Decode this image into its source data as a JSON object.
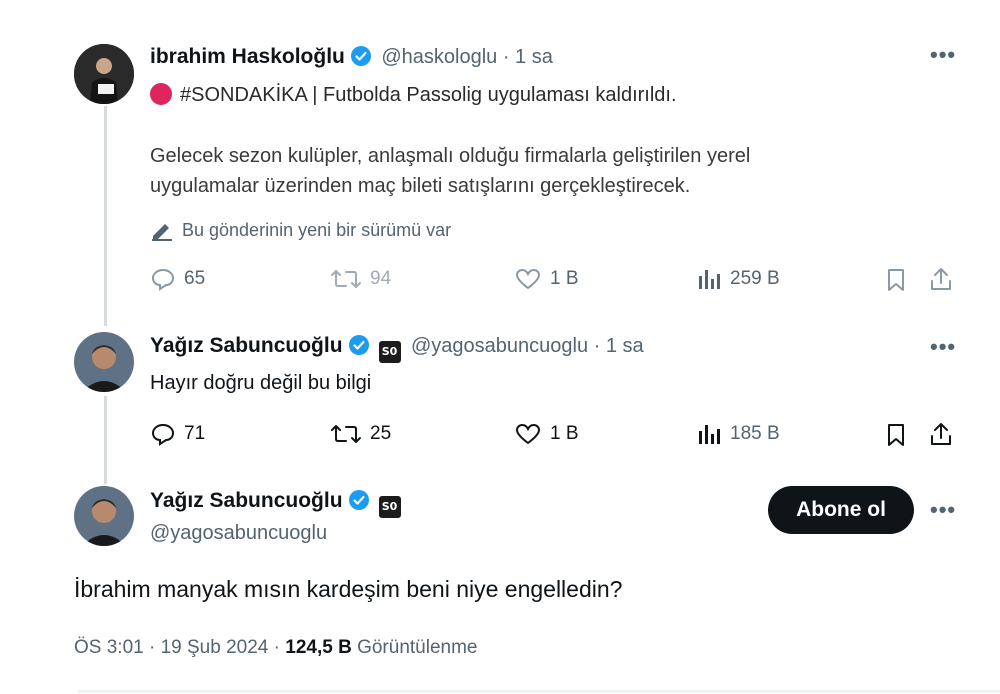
{
  "tweet1": {
    "author_name": "ibrahim Haskoloğlu",
    "handle_time": "@haskologlu · 1 sa",
    "headline": "#SONDAKİKA | Futbolda Passolig uygulaması kaldırıldı.",
    "body_line1": "Gelecek sezon kulüpler, anlaşmalı olduğu firmalarla geliştirilen yerel",
    "body_line2": "uygulamalar üzerinden maç bileti satışlarını gerçekleştirecek.",
    "edit_notice": "Bu gönderinin yeni bir sürümü var",
    "replies": "65",
    "retweets": "94",
    "likes": "1 B",
    "views": "259 B"
  },
  "tweet2": {
    "author_name": "Yağız Sabuncuoğlu",
    "badge": "S0",
    "handle_time": "@yagosabuncuoglu · 1 sa",
    "body": "Hayır doğru değil bu bilgi",
    "replies": "71",
    "retweets": "25",
    "likes": "1 B",
    "views": "185 B"
  },
  "main_tweet": {
    "author_name": "Yağız Sabuncuoğlu",
    "badge": "S0",
    "handle": "@yagosabuncuoglu",
    "subscribe_label": "Abone ol",
    "body": "İbrahim manyak mısın kardeşim beni niye engelledin?",
    "timestamp": "ÖS 3:01 · 19 Şub 2024 · ",
    "views_count": "124,5 B",
    "views_label": " Görüntülenme"
  },
  "colors": {
    "accent": "#1d9bf0",
    "text": "#0f1419",
    "muted": "#536471",
    "alert_red": "#e0245e"
  },
  "icons": {
    "more": "more-horizontal-icon",
    "reply": "reply-icon",
    "retweet": "retweet-icon",
    "like": "heart-icon",
    "views": "analytics-icon",
    "bookmark": "bookmark-icon",
    "share": "share-icon"
  }
}
